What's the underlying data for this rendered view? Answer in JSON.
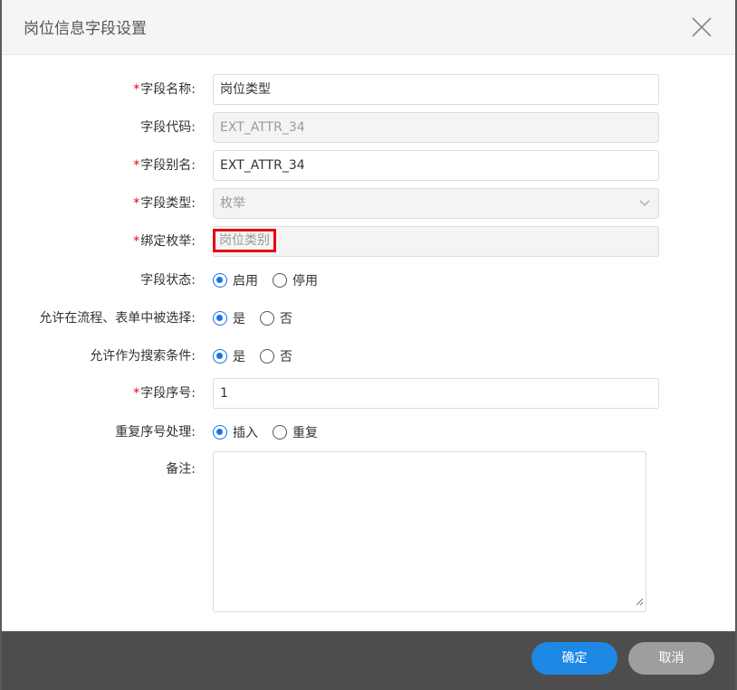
{
  "dialog": {
    "title": "岗位信息字段设置",
    "close_icon": "close-icon"
  },
  "form": {
    "field_name": {
      "required": "*",
      "label": "字段名称:",
      "value": "岗位类型"
    },
    "field_code": {
      "label": "字段代码:",
      "value": "EXT_ATTR_34"
    },
    "field_alias": {
      "required": "*",
      "label": "字段别名:",
      "value": "EXT_ATTR_34"
    },
    "field_type": {
      "required": "*",
      "label": "字段类型:",
      "value": "枚举"
    },
    "bind_enum": {
      "required": "*",
      "label": "绑定枚举:",
      "value": "岗位类别"
    },
    "field_status": {
      "label": "字段状态:",
      "options": [
        "启用",
        "停用"
      ],
      "selected": "启用"
    },
    "allow_selected": {
      "label": "允许在流程、表单中被选择:",
      "options": [
        "是",
        "否"
      ],
      "selected": "是"
    },
    "allow_search": {
      "label": "允许作为搜索条件:",
      "options": [
        "是",
        "否"
      ],
      "selected": "是"
    },
    "field_order": {
      "required": "*",
      "label": "字段序号:",
      "value": "1"
    },
    "duplicate_handling": {
      "label": "重复序号处理:",
      "options": [
        "插入",
        "重复"
      ],
      "selected": "插入"
    },
    "remark": {
      "label": "备注:",
      "value": ""
    }
  },
  "footer": {
    "ok_label": "确定",
    "cancel_label": "取消"
  },
  "colors": {
    "accent": "#1e88e5",
    "required": "#e60012",
    "highlight_box": "#e60012",
    "footer_bg": "#4d4d4d",
    "cancel_bg": "#9e9e9e"
  }
}
